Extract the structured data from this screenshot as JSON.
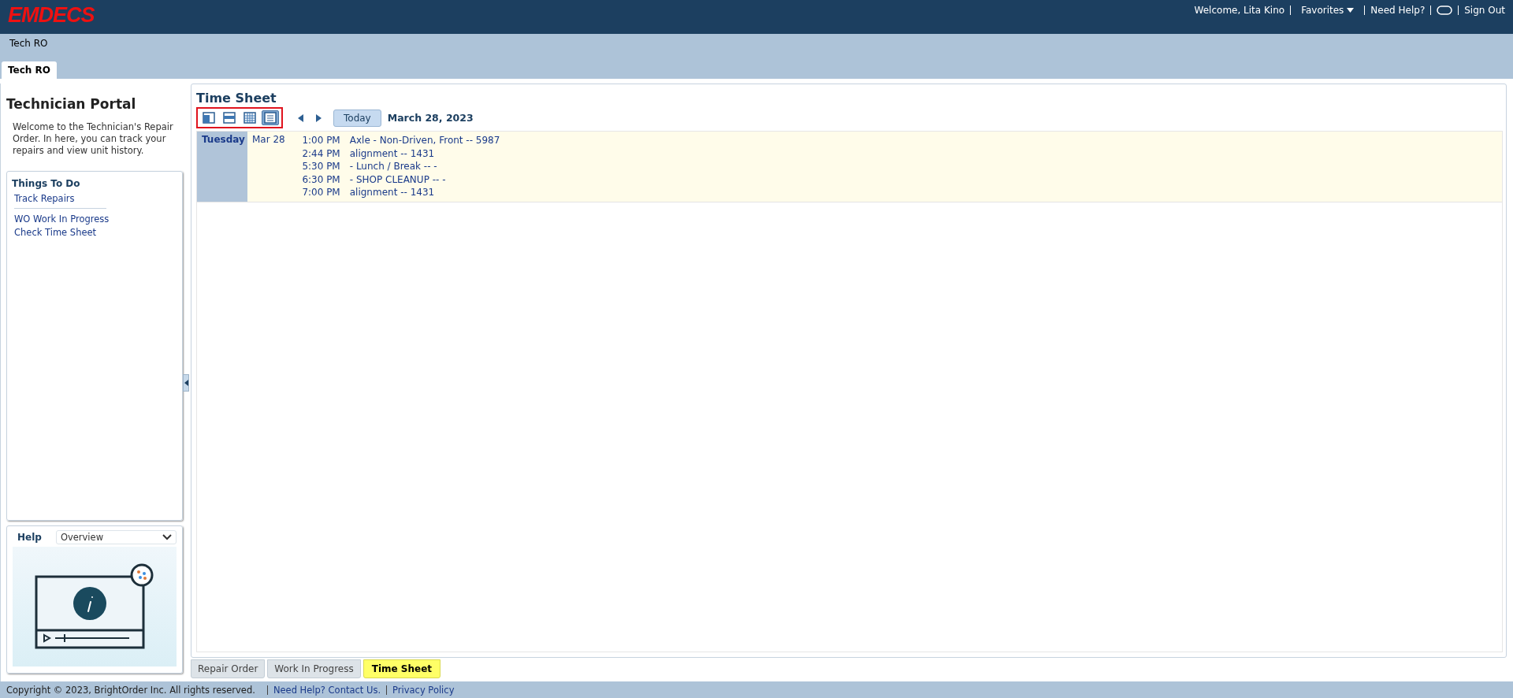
{
  "header": {
    "logo": "EMDECS",
    "welcome": "Welcome, Lita Kino",
    "links": [
      {
        "label": "Favorites",
        "kind": "dropdown"
      },
      {
        "label": "Need Help?",
        "kind": "link"
      },
      {
        "kind": "chat"
      },
      {
        "label": "Sign Out",
        "kind": "link"
      }
    ]
  },
  "breadcrumb": "Tech RO",
  "top_tabs": [
    {
      "label": "Tech RO",
      "selected": true
    }
  ],
  "sidebar": {
    "title": "Technician Portal",
    "intro": "Welcome to the Technician's Repair Order. In here, you can track your repairs and view unit history.",
    "things_to_do": {
      "title": "Things To Do",
      "groups": [
        [
          "Track Repairs"
        ],
        [
          "WO Work In Progress",
          "Check Time Sheet"
        ]
      ]
    },
    "help": {
      "title": "Help",
      "select_value": "Overview"
    }
  },
  "time_sheet": {
    "title": "Time Sheet",
    "view_buttons": [
      {
        "kind": "day",
        "selected": false
      },
      {
        "kind": "week",
        "selected": false
      },
      {
        "kind": "month",
        "selected": false
      },
      {
        "kind": "list",
        "selected": true
      }
    ],
    "today_button": "Today",
    "date": "March 28, 2023",
    "days": [
      {
        "day": "Tuesday",
        "date": "Mar 28",
        "entries": [
          {
            "time": "1:00 PM",
            "text": "Axle - Non-Driven, Front -- 5987"
          },
          {
            "time": "2:44 PM",
            "text": "alignment -- 1431"
          },
          {
            "time": "5:30 PM",
            "text": "- Lunch / Break -- -"
          },
          {
            "time": "6:30 PM",
            "text": "- SHOP CLEANUP -- -"
          },
          {
            "time": "7:00 PM",
            "text": "alignment -- 1431"
          }
        ]
      }
    ]
  },
  "bottom_tabs": [
    {
      "label": "Repair Order",
      "selected": false
    },
    {
      "label": "Work In Progress",
      "selected": false
    },
    {
      "label": "Time Sheet",
      "selected": true
    }
  ],
  "footer": {
    "copyright": "Copyright © 2023, BrightOrder Inc. All rights reserved.",
    "links": [
      "Need Help? Contact Us.",
      "Privacy Policy"
    ]
  }
}
